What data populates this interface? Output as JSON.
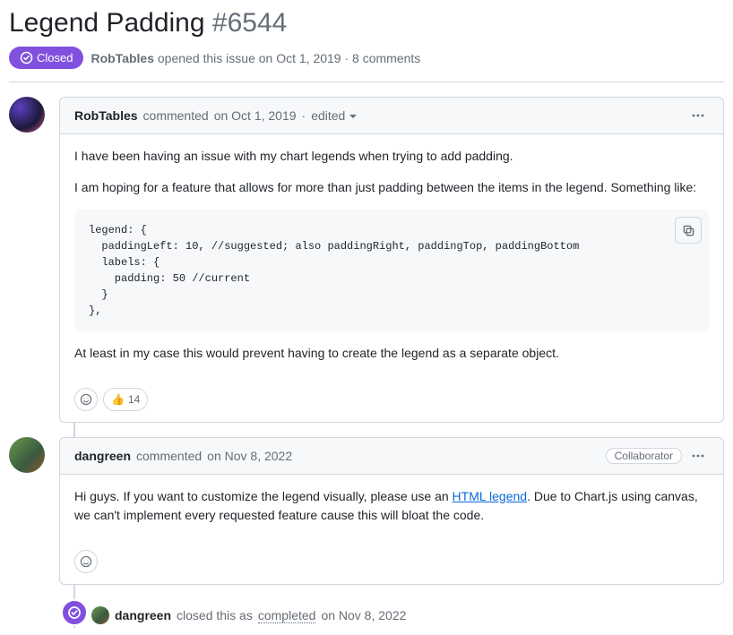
{
  "issue": {
    "title": "Legend Padding",
    "number": "#6544",
    "state_label": "Closed",
    "opened_author": "RobTables",
    "opened_middle": " opened this issue ",
    "opened_date": "on Oct 1, 2019",
    "opened_tail": " · 8 comments"
  },
  "comment1": {
    "author": "RobTables",
    "commented": " commented ",
    "date": "on Oct 1, 2019",
    "edited_sep": " · ",
    "edited": "edited",
    "p1": "I have been having an issue with my chart legends when trying to add padding.",
    "p2": "I am hoping for a feature that allows for more than just padding between the items in the legend. Something like:",
    "code": "legend: {\n  paddingLeft: 10, //suggested; also paddingRight, paddingTop, paddingBottom\n  labels: {\n    padding: 50 //current\n  }\n},",
    "p3": "At least in my case this would prevent having to create the legend as a separate object.",
    "thumbs_emoji": "👍",
    "thumbs_count": "14"
  },
  "comment2": {
    "author": "dangreen",
    "commented": " commented ",
    "date": "on Nov 8, 2022",
    "role": "Collaborator",
    "p1a": "Hi guys. If you want to customize the legend visually, please use an ",
    "p1_link": "HTML legend",
    "p1b": ". Due to Chart.js using canvas, we can't implement every requested feature cause this will bloat the code."
  },
  "closed_event": {
    "author": "dangreen",
    "middle": " closed this as ",
    "completed": "completed",
    "tail": " on Nov 8, 2022"
  }
}
